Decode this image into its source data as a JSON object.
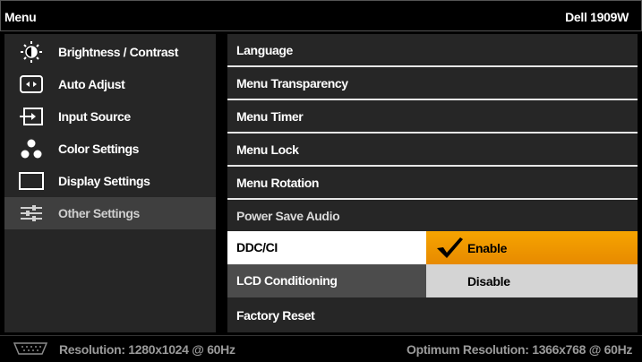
{
  "header": {
    "title": "Menu",
    "model": "Dell 1909W"
  },
  "sidebar": {
    "items": [
      {
        "label": "Brightness / Contrast",
        "icon": "brightness-icon"
      },
      {
        "label": "Auto Adjust",
        "icon": "auto-adjust-icon"
      },
      {
        "label": "Input Source",
        "icon": "input-source-icon"
      },
      {
        "label": "Color Settings",
        "icon": "color-settings-icon"
      },
      {
        "label": "Display Settings",
        "icon": "display-settings-icon"
      },
      {
        "label": "Other Settings",
        "icon": "other-settings-icon",
        "selected": true
      }
    ]
  },
  "panel": {
    "rows": [
      {
        "label": "Language"
      },
      {
        "label": "Menu Transparency"
      },
      {
        "label": "Menu Timer"
      },
      {
        "label": "Menu Lock"
      },
      {
        "label": "Menu Rotation"
      },
      {
        "label": "Power Save Audio"
      },
      {
        "label": "DDC/CI",
        "selected": true
      },
      {
        "label": "LCD Conditioning"
      },
      {
        "label": "Factory Reset"
      }
    ],
    "ddc_options": {
      "enable": "Enable",
      "disable": "Disable",
      "current": "Enable"
    }
  },
  "status": {
    "resolution": "Resolution: 1280x1024 @ 60Hz",
    "optimum": "Optimum Resolution: 1366x768 @ 60Hz",
    "icon": "vga-connector-icon"
  },
  "colors": {
    "highlight": "#f0a000",
    "panel": "#262626",
    "separator": "#e6e6e6"
  }
}
